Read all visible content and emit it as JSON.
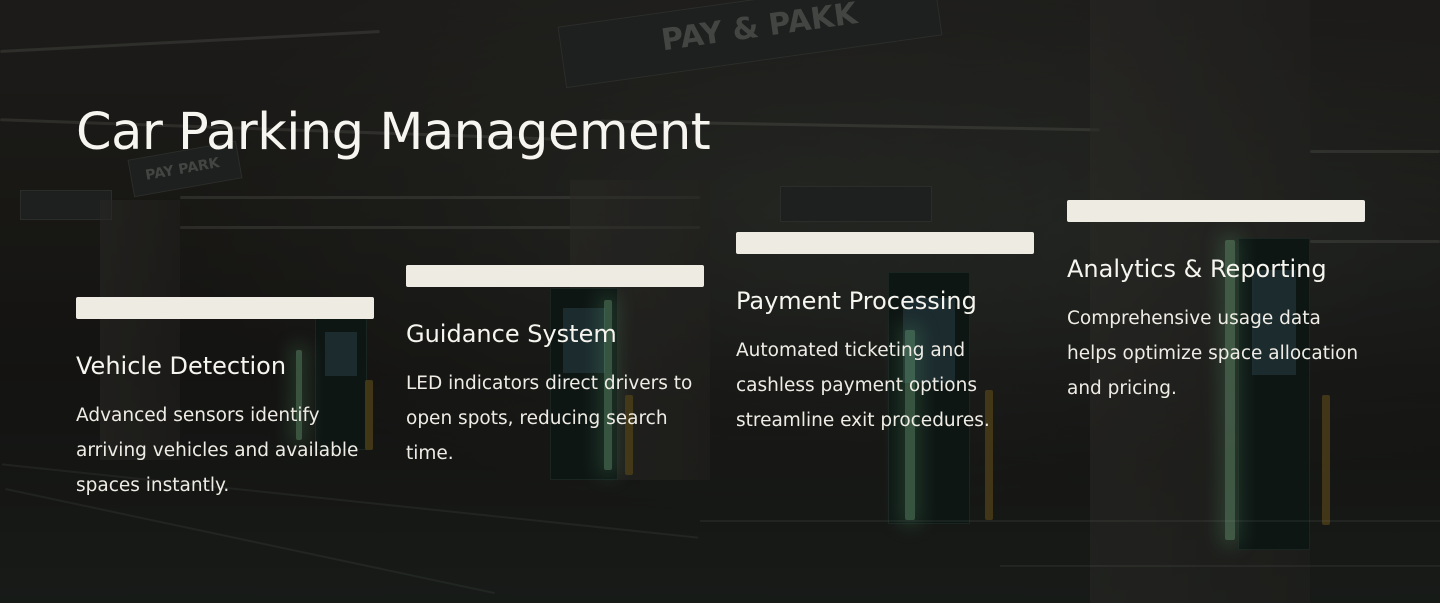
{
  "page": {
    "title": "Car Parking Management"
  },
  "background": {
    "description_signs": [
      "PAY & PAKK",
      "PAY PARK"
    ]
  },
  "features": [
    {
      "title": "Vehicle Detection",
      "description": "Advanced sensors identify arriving vehicles and available spaces instantly."
    },
    {
      "title": "Guidance System",
      "description": "LED indicators direct drivers to open spots, reducing search time."
    },
    {
      "title": "Payment Processing",
      "description": "Automated ticketing and cashless payment options streamline exit procedures."
    },
    {
      "title": "Analytics & Reporting",
      "description": "Comprehensive usage data helps optimize space allocation and pricing."
    }
  ],
  "colors": {
    "bar": "#eeebe3",
    "text": "#f7f5ef",
    "background": "#1c1b19"
  }
}
